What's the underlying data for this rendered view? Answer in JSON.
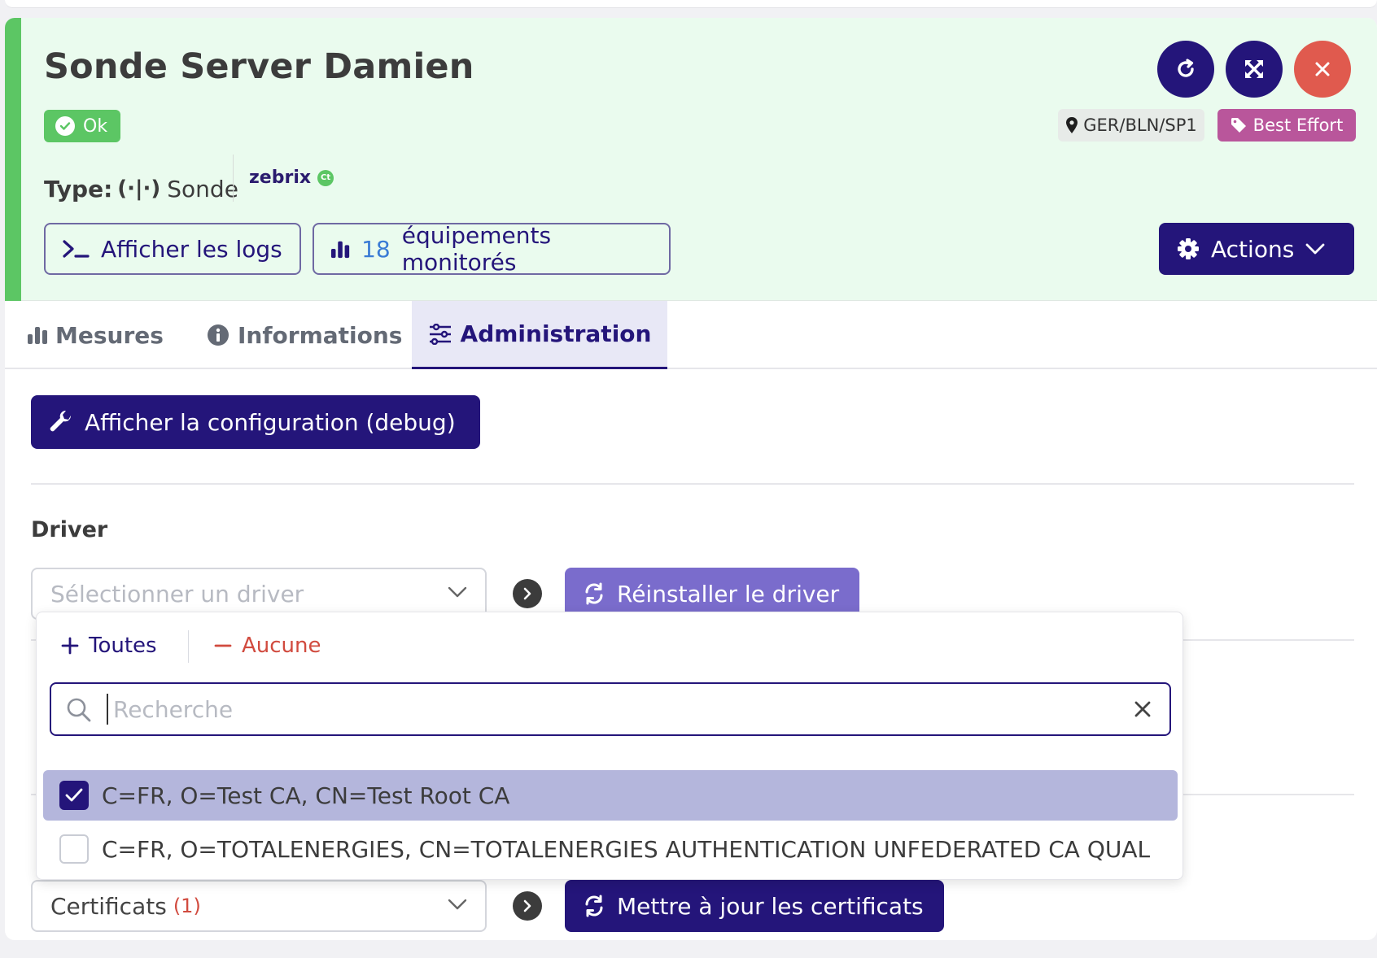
{
  "header": {
    "title": "Sonde Server Damien",
    "status": "Ok",
    "type_label": "Type:",
    "type_icon": "(·|·)",
    "type_value": "Sonde",
    "brand": "zebrix",
    "brand_badge": "Ct",
    "location": "GER/BLN/SP1",
    "tag": "Best Effort",
    "logs_button": "Afficher les logs",
    "devices_count": "18",
    "devices_label": "équipements monitorés",
    "actions_button": "Actions"
  },
  "tabs": [
    {
      "label": "Mesures"
    },
    {
      "label": "Informations"
    },
    {
      "label": "Administration"
    }
  ],
  "admin": {
    "debug_button": "Afficher la configuration (debug)",
    "driver_label": "Driver",
    "driver_placeholder": "Sélectionner un driver",
    "reinstall_button": "Réinstaller le driver",
    "cert_select_label": "Certificats",
    "cert_select_count": "(1)",
    "update_cert_button": "Mettre à jour les certificats"
  },
  "dropdown": {
    "select_all": "Toutes",
    "select_none": "Aucune",
    "search_placeholder": "Recherche",
    "options": [
      {
        "label": "C=FR, O=Test CA, CN=Test Root CA",
        "checked": true
      },
      {
        "label": "C=FR, O=TOTALENERGIES, CN=TOTALENERGIES AUTHENTICATION UNFEDERATED CA QUAL",
        "checked": false
      }
    ]
  },
  "colors": {
    "primary": "#24157a",
    "success": "#5cc664",
    "danger": "#e05a4e",
    "tag": "#b9569b",
    "header_bg": "#eafbee"
  }
}
